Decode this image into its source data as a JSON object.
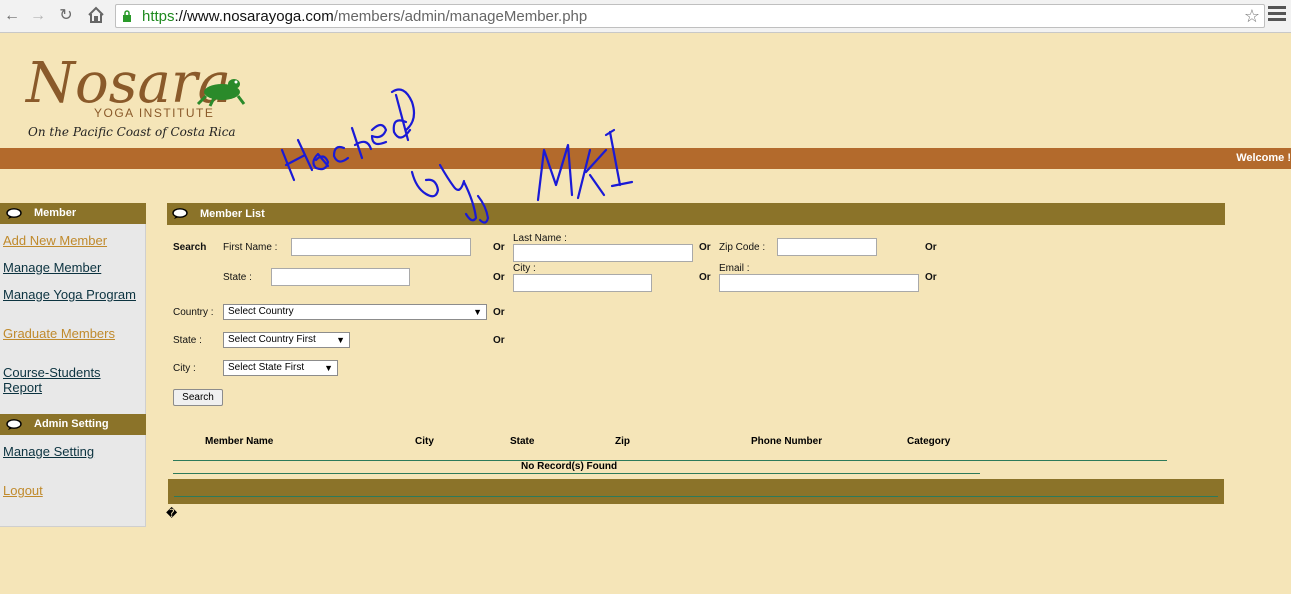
{
  "browser": {
    "url_protocol": "https",
    "url_host": "://www.nosarayoga.com",
    "url_path": "/members/admin/manageMember.php"
  },
  "header": {
    "logo_text": "Nosara",
    "logo_sub": "YOGA INSTITUTE",
    "tagline": "On the Pacific Coast of Costa Rica",
    "welcome": "Welcome !",
    "graffiti": "Hacked by MKI"
  },
  "sidebar": {
    "member_title": "Member",
    "member_links": [
      "Add New Member",
      "Manage Member",
      "Manage Yoga Program",
      "Graduate Members",
      "Course-Students",
      "Report"
    ],
    "admin_title": "Admin Setting",
    "admin_links": [
      "Manage Setting",
      "Logout"
    ]
  },
  "main": {
    "title": "Member List",
    "search_label": "Search",
    "first_name": "First Name :",
    "last_name": "Last Name :",
    "zip_code": "Zip Code :",
    "state": "State :",
    "city": "City :",
    "email": "Email :",
    "country_label": "Country :",
    "state_label": "State :",
    "city_label": "City :",
    "or": "Or",
    "country_select": "Select Country",
    "state_select": "Select Country First",
    "city_select": "Select State First",
    "search_button": "Search",
    "columns": [
      "Member Name",
      "City",
      "State",
      "Zip",
      "Phone Number",
      "Category"
    ],
    "no_records": "No Record(s) Found",
    "stray_char": "�"
  },
  "colors": {
    "page_bg": "#f5e5b8",
    "header_bar": "#b36a2c",
    "section_bar": "#8b7329",
    "link_orange": "#c08a2c",
    "graffiti_ink": "#1a1ad6"
  }
}
